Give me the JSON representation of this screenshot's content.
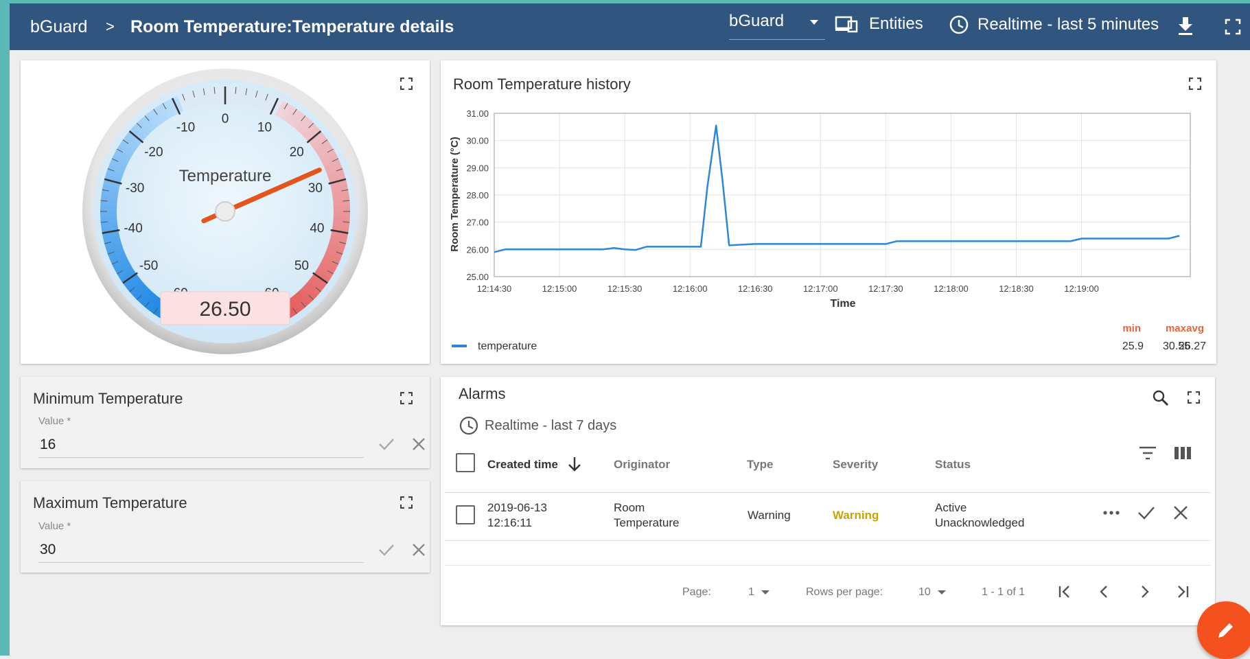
{
  "header": {
    "breadcrumb_root": "bGuard",
    "breadcrumb_sep": ">",
    "breadcrumb_current": "Room Temperature:Temperature details",
    "dashboard_select": "bGuard",
    "entities_label": "Entities",
    "timewindow_label": "Realtime - last 5 minutes"
  },
  "gauge": {
    "title": "Temperature",
    "value": 26.5,
    "display": "26.50",
    "min": -60,
    "max": 60,
    "ticks": [
      "-60",
      "-50",
      "-40",
      "-30",
      "-20",
      "-10",
      "0",
      "10",
      "20",
      "30",
      "40",
      "50",
      "60"
    ]
  },
  "min_temp": {
    "title": "Minimum Temperature",
    "label": "Value *",
    "value": "16"
  },
  "max_temp": {
    "title": "Maximum Temperature",
    "label": "Value *",
    "value": "30"
  },
  "history": {
    "title": "Room Temperature history",
    "legend": {
      "name": "temperature",
      "min_label": "min",
      "max_label": "max",
      "avg_label": "avg",
      "min": "25.9",
      "max": "30.55",
      "avg": "26.27"
    }
  },
  "chart_data": {
    "type": "line",
    "title": "Room Temperature history",
    "xlabel": "Time",
    "ylabel": "Room Temperature (°C)",
    "ylim": [
      25.0,
      31.0
    ],
    "yticks": [
      "25.00",
      "26.00",
      "27.00",
      "28.00",
      "29.00",
      "30.00",
      "31.00"
    ],
    "xticks": [
      "12:14:30",
      "12:15:00",
      "12:15:30",
      "12:16:00",
      "12:16:30",
      "12:17:00",
      "12:17:30",
      "12:18:00",
      "12:18:30",
      "12:19:00"
    ],
    "xlim": [
      "12:14:30",
      "12:19:50"
    ],
    "grid": true,
    "legend_position": "bottom",
    "series": [
      {
        "name": "temperature",
        "color": "#2f86d6",
        "x": [
          "12:14:30",
          "12:14:35",
          "12:14:40",
          "12:15:00",
          "12:15:20",
          "12:15:25",
          "12:15:30",
          "12:15:35",
          "12:15:40",
          "12:16:00",
          "12:16:05",
          "12:16:08",
          "12:16:12",
          "12:16:15",
          "12:16:18",
          "12:16:30",
          "12:17:00",
          "12:17:30",
          "12:17:35",
          "12:18:00",
          "12:18:30",
          "12:18:55",
          "12:19:00",
          "12:19:40",
          "12:19:45"
        ],
        "y": [
          25.9,
          26.0,
          26.0,
          26.0,
          26.0,
          26.05,
          26.0,
          25.98,
          26.1,
          26.1,
          26.1,
          28.3,
          30.55,
          28.5,
          26.15,
          26.2,
          26.2,
          26.2,
          26.3,
          26.3,
          26.3,
          26.3,
          26.4,
          26.4,
          26.5
        ]
      }
    ]
  },
  "alarms": {
    "title": "Alarms",
    "timewindow": "Realtime - last 7 days",
    "columns": [
      "Created time",
      "Originator",
      "Type",
      "Severity",
      "Status"
    ],
    "rows": [
      {
        "created_date": "2019-06-13",
        "created_time": "12:16:11",
        "originator_1": "Room",
        "originator_2": "Temperature",
        "type": "Warning",
        "severity": "Warning",
        "status_1": "Active",
        "status_2": "Unacknowledged"
      }
    ],
    "severity_color": "#c9a400",
    "pagination": {
      "page_label": "Page:",
      "page": "1",
      "rows_label": "Rows per page:",
      "rows": "10",
      "range": "1 - 1 of 1"
    }
  },
  "colors": {
    "header_bg": "#305680",
    "accent_teal": "#5bb8b4",
    "fab": "#f4511e",
    "legend_stat_label": "#e8643c"
  }
}
